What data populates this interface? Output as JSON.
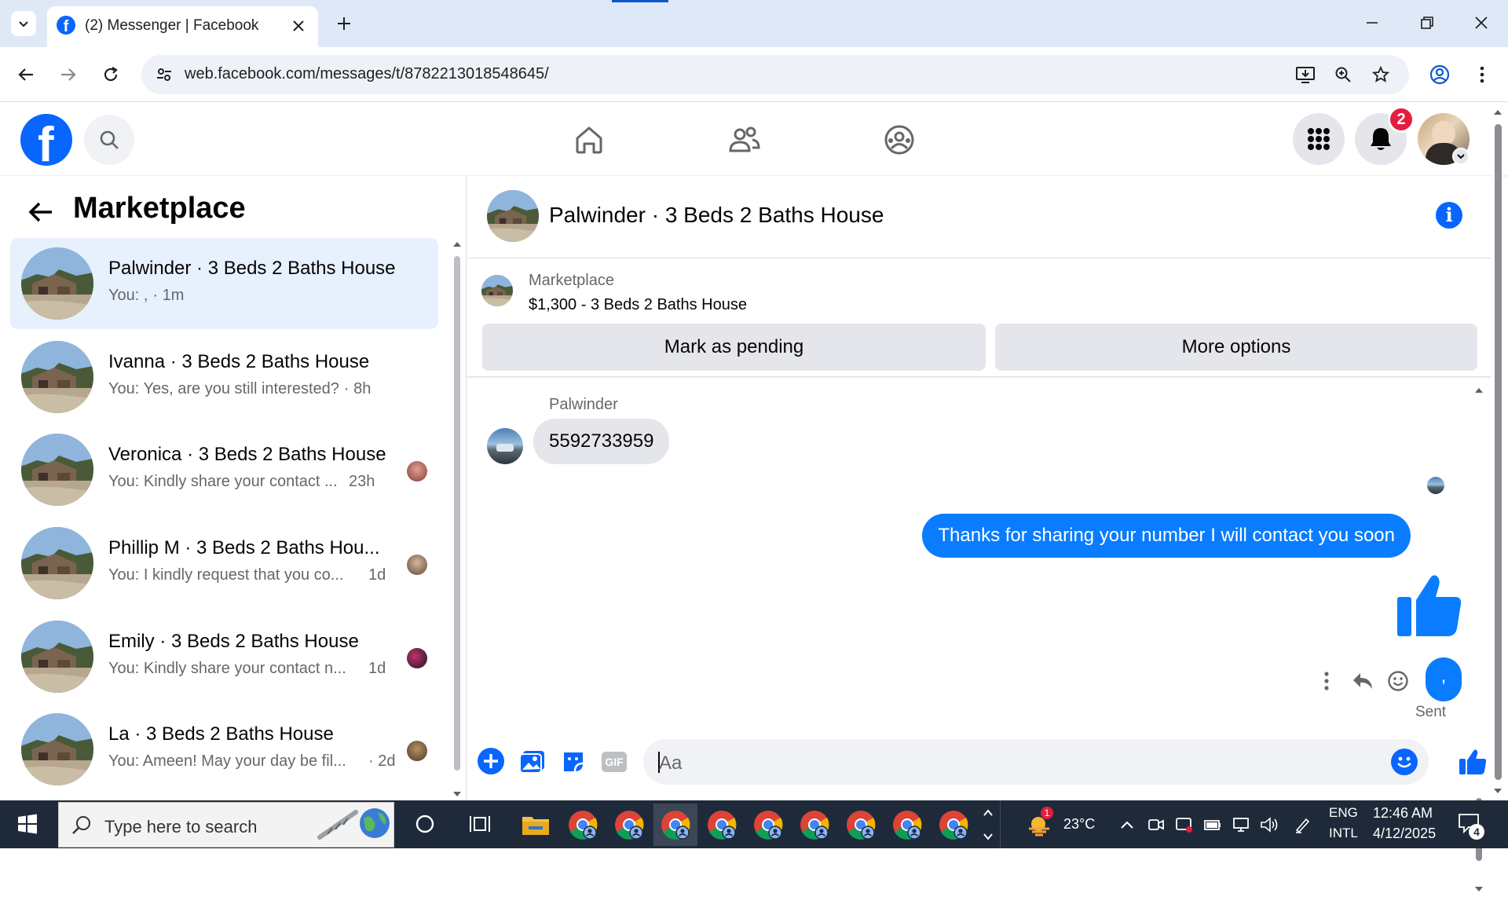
{
  "browser": {
    "tab_title": "(2) Messenger | Facebook",
    "url": "web.facebook.com/messages/t/8782213018548645/"
  },
  "header": {
    "notification_count": "2"
  },
  "sidebar": {
    "title": "Marketplace",
    "conversations": [
      {
        "name": "Palwinder · 3 Beds 2 Baths House",
        "preview": "You: ,",
        "time": "· 1m",
        "active": true
      },
      {
        "name": "Ivanna · 3 Beds 2 Baths House",
        "preview": "You: Yes, are you still interested?",
        "time": "· 8h"
      },
      {
        "name": "Veronica · 3 Beds 2 Baths House",
        "preview": "You: Kindly share your contact ...",
        "time": "23h"
      },
      {
        "name": "Phillip M · 3 Beds 2 Baths Hou...",
        "preview": "You: I kindly request that you co...",
        "time": "1d"
      },
      {
        "name": "Emily · 3 Beds 2 Baths House",
        "preview": "You: Kindly share your contact n...",
        "time": "1d"
      },
      {
        "name": "La · 3 Beds 2 Baths House",
        "preview": "You: Ameen! May your day be fil...",
        "time": "· 2d"
      }
    ]
  },
  "chat": {
    "title": "Palwinder · 3 Beds 2 Baths House",
    "marketplace_label": "Marketplace",
    "listing": "$1,300 - 3 Beds 2 Baths House",
    "mark_pending": "Mark as pending",
    "more_options": "More options",
    "sender_name": "Palwinder",
    "incoming_message": "5592733959",
    "outgoing_message": "Thanks for sharing your number I will contact you soon",
    "last_bubble": ",",
    "status": "Sent",
    "composer_placeholder": "Aa",
    "gif_label": "GIF"
  },
  "taskbar": {
    "search_placeholder": "Type here to search",
    "weather": "23°C",
    "weather_badge": "1",
    "lang_top": "ENG",
    "lang_bottom": "INTL",
    "time": "12:46 AM",
    "date": "4/12/2025",
    "action_center_count": "4"
  },
  "colors": {
    "facebook_blue": "#0866ff",
    "messenger_blue": "#0a7cff",
    "notification_red": "#e41e3f",
    "active_conversation_bg": "#e7f0fd"
  }
}
